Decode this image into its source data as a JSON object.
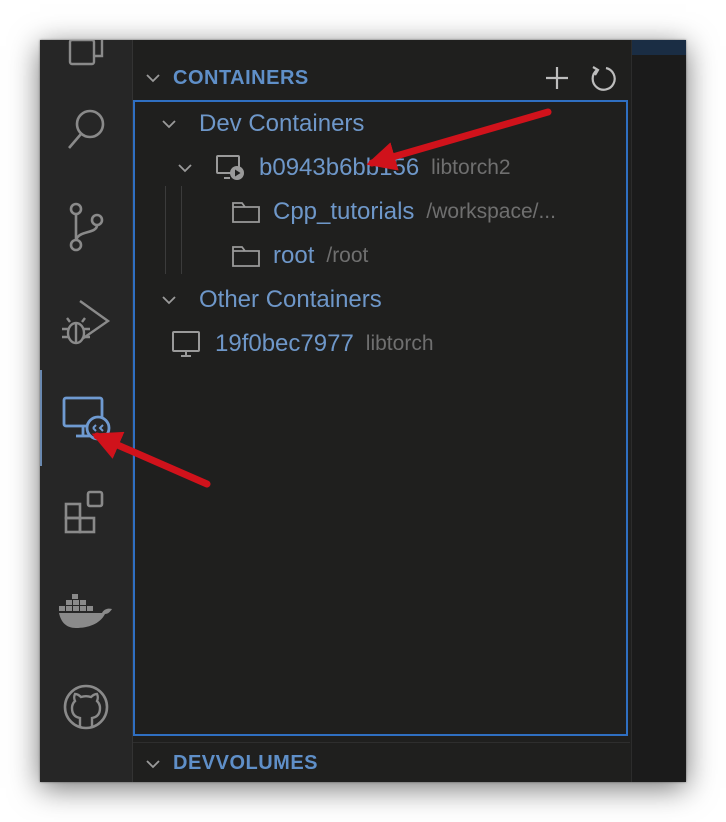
{
  "activity_bar": {
    "items": [
      {
        "icon": "explorer-icon"
      },
      {
        "icon": "search-icon"
      },
      {
        "icon": "source-control-icon"
      },
      {
        "icon": "run-debug-icon"
      },
      {
        "icon": "remote-explorer-icon",
        "active": true
      },
      {
        "icon": "extensions-icon"
      },
      {
        "icon": "docker-icon"
      },
      {
        "icon": "github-icon"
      }
    ]
  },
  "sidebar": {
    "containers_section": {
      "title": "CONTAINERS",
      "actions": [
        "add-icon",
        "refresh-icon"
      ],
      "groups": [
        {
          "label": "Dev Containers",
          "items": [
            {
              "name": "b0943b6bb156",
              "description": "libtorch2",
              "icon": "running-container-icon",
              "children": [
                {
                  "name": "Cpp_tutorials",
                  "description": "/workspace/...",
                  "icon": "folder-icon"
                },
                {
                  "name": "root",
                  "description": "/root",
                  "icon": "folder-icon"
                }
              ]
            }
          ]
        },
        {
          "label": "Other Containers",
          "items": [
            {
              "name": "19f0bec7977",
              "description": "libtorch",
              "icon": "monitor-icon"
            }
          ]
        }
      ]
    },
    "devvolumes_section": {
      "title": "DEVVOLUMES"
    }
  },
  "annotations": {
    "arrow_color": "#d0121b",
    "accent_color": "#5f8fc8",
    "focus_border_color": "#2f6fc2"
  }
}
